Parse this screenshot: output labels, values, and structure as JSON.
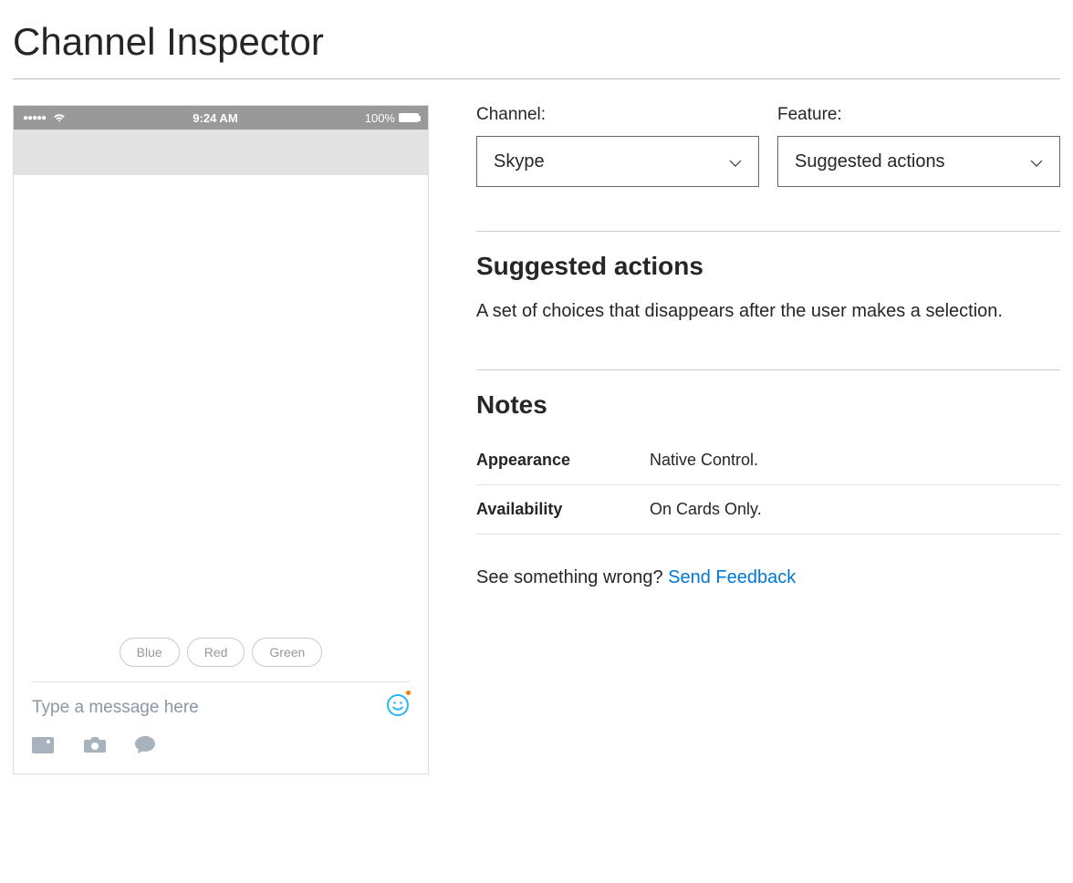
{
  "page": {
    "title": "Channel Inspector"
  },
  "phone": {
    "status": {
      "time": "9:24 AM",
      "battery_text": "100%"
    },
    "suggested_actions": [
      "Blue",
      "Red",
      "Green"
    ],
    "composer": {
      "placeholder": "Type a message here"
    }
  },
  "controls": {
    "channel_label": "Channel:",
    "channel_selected": "Skype",
    "feature_label": "Feature:",
    "feature_selected": "Suggested actions"
  },
  "feature_section": {
    "heading": "Suggested actions",
    "description": "A set of choices that disappears after the user makes a selection."
  },
  "notes": {
    "heading": "Notes",
    "rows": [
      {
        "label": "Appearance",
        "value": "Native Control."
      },
      {
        "label": "Availability",
        "value": "On Cards Only."
      }
    ]
  },
  "feedback": {
    "prompt": "See something wrong? ",
    "link_text": "Send Feedback"
  }
}
